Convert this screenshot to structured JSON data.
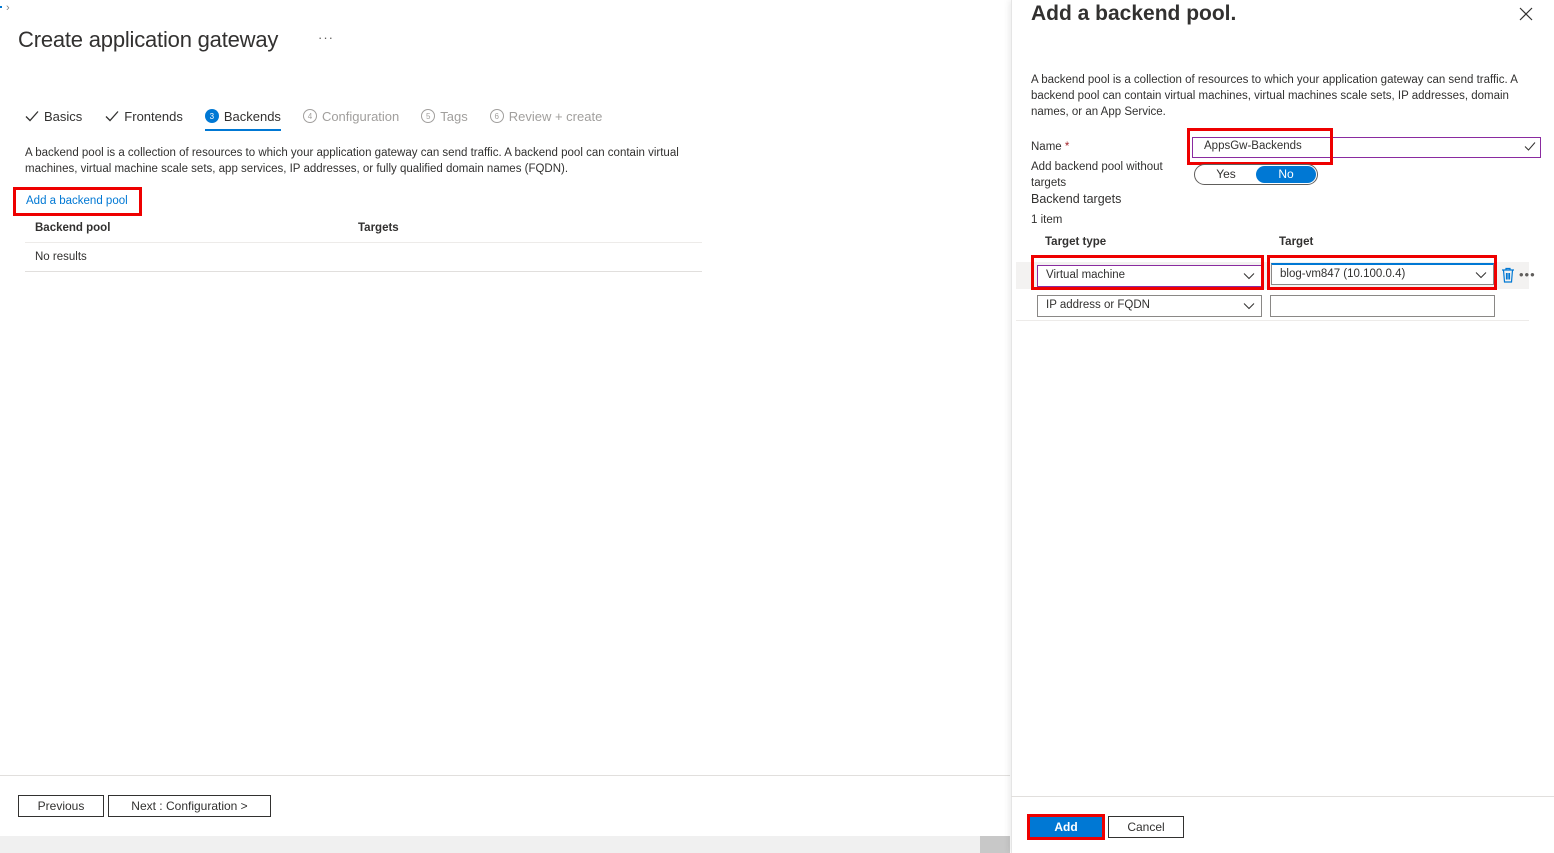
{
  "breadcrumb": {
    "chevron": "›"
  },
  "page": {
    "title": "Create application gateway",
    "more_label": "···"
  },
  "tabs": [
    {
      "label": "Basics",
      "state": "complete",
      "marker": "check-icon"
    },
    {
      "label": "Frontends",
      "state": "complete",
      "marker": "check-icon"
    },
    {
      "label": "Backends",
      "state": "active",
      "marker": "3"
    },
    {
      "label": "Configuration",
      "state": "disabled",
      "marker": "4"
    },
    {
      "label": "Tags",
      "state": "disabled",
      "marker": "5"
    },
    {
      "label": "Review + create",
      "state": "disabled",
      "marker": "6"
    }
  ],
  "main": {
    "description": "A backend pool is a collection of resources to which your application gateway can send traffic. A backend pool can contain virtual machines, virtual machine scale sets, app services, IP addresses, or fully qualified domain names (FQDN).",
    "add_link": "Add a backend pool",
    "table": {
      "columns": [
        "Backend pool",
        "Targets"
      ],
      "empty_text": "No results"
    }
  },
  "footer": {
    "previous_label": "Previous",
    "next_label": "Next : Configuration >"
  },
  "panel": {
    "title": "Add a backend pool.",
    "description": "A backend pool is a collection of resources to which your application gateway can send traffic. A backend pool can contain virtual machines, virtual machines scale sets, IP addresses, domain names, or an App Service.",
    "name_label": "Name",
    "required_mark": "*",
    "name_value": "AppsGw-Backends",
    "without_targets_label": "Add backend pool without targets",
    "toggle": {
      "options": [
        "Yes",
        "No"
      ],
      "selected": "No"
    },
    "backend_targets_label": "Backend targets",
    "item_count": "1 item",
    "columns": {
      "target_type": "Target type",
      "target": "Target"
    },
    "rows": [
      {
        "target_type": "Virtual machine",
        "target": "blog-vm847 (10.100.0.4)"
      },
      {
        "target_type": "IP address or FQDN",
        "target": ""
      }
    ],
    "add_label": "Add",
    "cancel_label": "Cancel"
  },
  "colors": {
    "accent": "#0078d4",
    "highlight": "#ee0000",
    "focus_border": "#8a2ba0",
    "required": "#a4262c"
  }
}
